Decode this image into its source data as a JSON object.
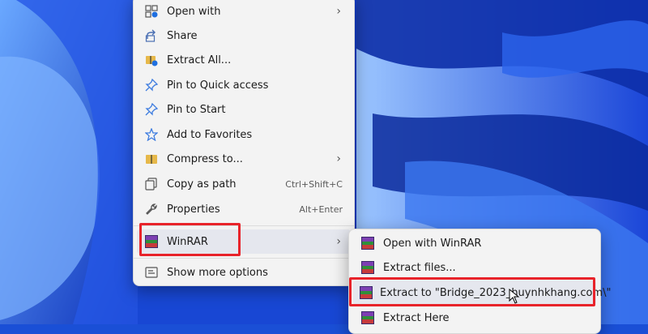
{
  "context_menu": {
    "items": [
      {
        "label": "Open with",
        "icon": "open-with-icon",
        "submenu": true
      },
      {
        "label": "Share",
        "icon": "share-icon"
      },
      {
        "label": "Extract All...",
        "icon": "extract-all-icon"
      },
      {
        "label": "Pin to Quick access",
        "icon": "pin-icon"
      },
      {
        "label": "Pin to Start",
        "icon": "pin-icon"
      },
      {
        "label": "Add to Favorites",
        "icon": "star-icon"
      },
      {
        "label": "Compress to...",
        "icon": "compress-icon",
        "submenu": true
      },
      {
        "label": "Copy as path",
        "icon": "copy-path-icon",
        "shortcut": "Ctrl+Shift+C"
      },
      {
        "label": "Properties",
        "icon": "wrench-icon",
        "shortcut": "Alt+Enter"
      },
      {
        "label": "WinRAR",
        "icon": "winrar-icon",
        "submenu": true
      },
      {
        "label": "Show more options",
        "icon": "more-options-icon"
      }
    ]
  },
  "winrar_submenu": {
    "items": [
      {
        "label": "Open with WinRAR",
        "icon": "winrar-icon"
      },
      {
        "label": "Extract files...",
        "icon": "winrar-icon"
      },
      {
        "label": "Extract to \"Bridge_2023_huynhkhang.com\\\"",
        "icon": "winrar-icon"
      },
      {
        "label": "Extract Here",
        "icon": "winrar-icon"
      }
    ]
  },
  "colors": {
    "highlight": "#e8232a",
    "accent": "#1a4fd6"
  }
}
